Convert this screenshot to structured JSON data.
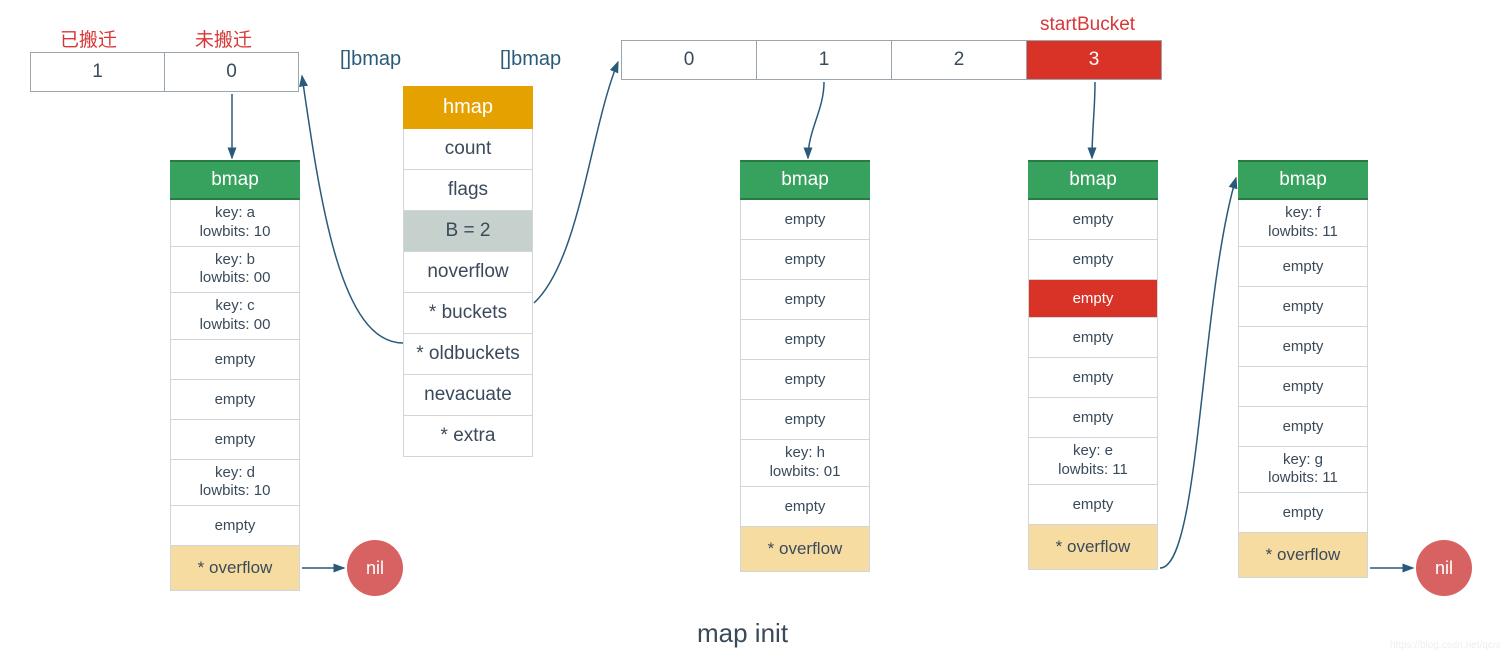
{
  "labels": {
    "migrated": "已搬迁",
    "not_migrated": "未搬迁",
    "bmap_left": "[]bmap",
    "bmap_right": "[]bmap",
    "start_bucket": "startBucket",
    "nil": "nil",
    "overflow": "* overflow",
    "caption": "map init"
  },
  "old_buckets": {
    "cells": [
      "1",
      "0"
    ]
  },
  "new_buckets": {
    "cells": [
      "0",
      "1",
      "2",
      "3"
    ],
    "highlight_index": 3
  },
  "hmap": {
    "title": "hmap",
    "rows": [
      {
        "t": "count",
        "style": ""
      },
      {
        "t": "flags",
        "style": ""
      },
      {
        "t": "B = 2",
        "style": "gr"
      },
      {
        "t": "noverflow",
        "style": ""
      },
      {
        "t": "* buckets",
        "style": ""
      },
      {
        "t": "* oldbuckets",
        "style": ""
      },
      {
        "t": "nevacuate",
        "style": ""
      },
      {
        "t": "* extra",
        "style": ""
      }
    ]
  },
  "bmap_old0": {
    "title": "bmap",
    "slots": [
      {
        "l1": "key: a",
        "l2": "lowbits: 10"
      },
      {
        "l1": "key: b",
        "l2": "lowbits: 00"
      },
      {
        "l1": "key: c",
        "l2": "lowbits: 00"
      },
      {
        "empty": true
      },
      {
        "empty": true
      },
      {
        "empty": true
      },
      {
        "l1": "key: d",
        "l2": "lowbits: 10"
      },
      {
        "empty": true
      }
    ]
  },
  "bmap_new1": {
    "title": "bmap",
    "slots": [
      {
        "empty": true
      },
      {
        "empty": true
      },
      {
        "empty": true
      },
      {
        "empty": true
      },
      {
        "empty": true
      },
      {
        "empty": true
      },
      {
        "l1": "key: h",
        "l2": "lowbits: 01"
      },
      {
        "empty": true
      }
    ]
  },
  "bmap_new3": {
    "title": "bmap",
    "slots": [
      {
        "empty": true
      },
      {
        "empty": true
      },
      {
        "empty": true,
        "red": true
      },
      {
        "empty": true
      },
      {
        "empty": true
      },
      {
        "empty": true
      },
      {
        "l1": "key: e",
        "l2": "lowbits: 11"
      },
      {
        "empty": true
      }
    ]
  },
  "bmap_ovf": {
    "title": "bmap",
    "slots": [
      {
        "l1": "key: f",
        "l2": "lowbits: 11"
      },
      {
        "empty": true
      },
      {
        "empty": true
      },
      {
        "empty": true
      },
      {
        "empty": true
      },
      {
        "empty": true
      },
      {
        "l1": "key: g",
        "l2": "lowbits: 11"
      },
      {
        "empty": true
      }
    ]
  },
  "empty_text": "empty"
}
